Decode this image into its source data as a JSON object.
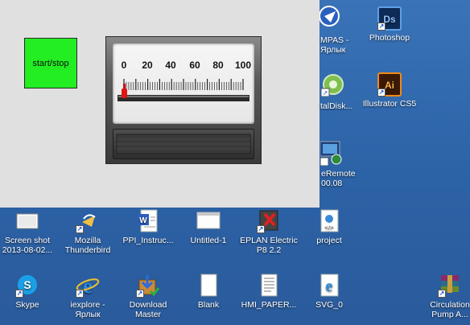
{
  "app": {
    "start_stop_label": "start/stop",
    "meter": {
      "scale_labels": [
        "0",
        "20",
        "40",
        "60",
        "80",
        "100"
      ],
      "min": 0,
      "max": 100,
      "value": 0
    }
  },
  "desktop": {
    "right_column": [
      {
        "label_line1": "MPAS -",
        "label_line2": "Ярлык",
        "icon": "compass-icon"
      },
      {
        "label_line1": "talDisk...",
        "label_line2": "",
        "icon": "disk-icon"
      },
      {
        "label_line1": "eRemote",
        "label_line2": "00.08",
        "icon": "remote-icon"
      }
    ],
    "icons": [
      {
        "name": "photoshop",
        "line1": "Photoshop",
        "line2": "",
        "icon": "photoshop-icon"
      },
      {
        "name": "illustrator",
        "line1": "Illustrator CS5",
        "line2": "",
        "icon": "illustrator-icon"
      },
      {
        "name": "screen-shot",
        "line1": "Screen shot",
        "line2": "2013-08-02...",
        "icon": "screenshot-icon"
      },
      {
        "name": "thunderbird",
        "line1": "Mozilla",
        "line2": "Thunderbird",
        "icon": "thunderbird-icon"
      },
      {
        "name": "ppi-instruct",
        "line1": "PPI_Instruc...",
        "line2": "",
        "icon": "word-doc-icon"
      },
      {
        "name": "untitled-1",
        "line1": "Untitled-1",
        "line2": "",
        "icon": "document-icon"
      },
      {
        "name": "eplan",
        "line1": "EPLAN Electric",
        "line2": "P8 2.2",
        "icon": "eplan-icon"
      },
      {
        "name": "project",
        "line1": "project",
        "line2": "",
        "icon": "html-file-icon"
      },
      {
        "name": "skype",
        "line1": "Skype",
        "line2": "",
        "icon": "skype-icon"
      },
      {
        "name": "iexplore",
        "line1": "iexplore -",
        "line2": "Ярлык",
        "icon": "ie-icon"
      },
      {
        "name": "download-master",
        "line1": "Download",
        "line2": "Master",
        "icon": "download-master-icon"
      },
      {
        "name": "blank",
        "line1": "Blank",
        "line2": "",
        "icon": "blank-doc-icon"
      },
      {
        "name": "hmi-paper",
        "line1": "HMI_PAPER...",
        "line2": "",
        "icon": "doc-icon"
      },
      {
        "name": "svg-0",
        "line1": "SVG_0",
        "line2": "",
        "icon": "ie-icon"
      },
      {
        "name": "circulation-pump",
        "line1": "Circulation",
        "line2": "Pump A...",
        "icon": "winrar-icon"
      }
    ]
  }
}
